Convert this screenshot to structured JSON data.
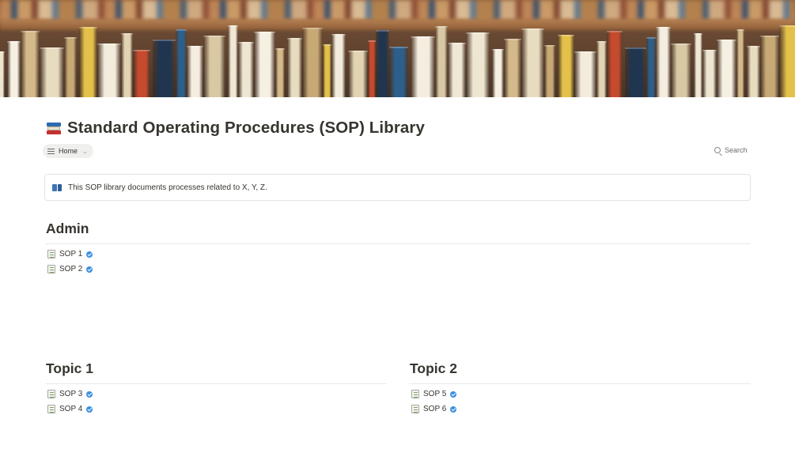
{
  "page": {
    "title": "Standard Operating Procedures (SOP) Library",
    "title_icon": "books-icon"
  },
  "view": {
    "tab_label": "Home",
    "search_label": "Search"
  },
  "callout": {
    "icon": "open-book-icon",
    "text": "This SOP library documents processes related to X, Y, Z."
  },
  "sections": {
    "admin": {
      "title": "Admin",
      "items": [
        "SOP 1",
        "SOP 2"
      ]
    },
    "topic1": {
      "title": "Topic 1",
      "items": [
        "SOP 3",
        "SOP 4"
      ]
    },
    "topic2": {
      "title": "Topic 2",
      "items": [
        "SOP 5",
        "SOP 6"
      ]
    }
  },
  "colors": {
    "text": "#37352f",
    "verified_badge": "#3d8fe0",
    "divider": "#e9e9e7",
    "tab_background": "#efefee"
  }
}
